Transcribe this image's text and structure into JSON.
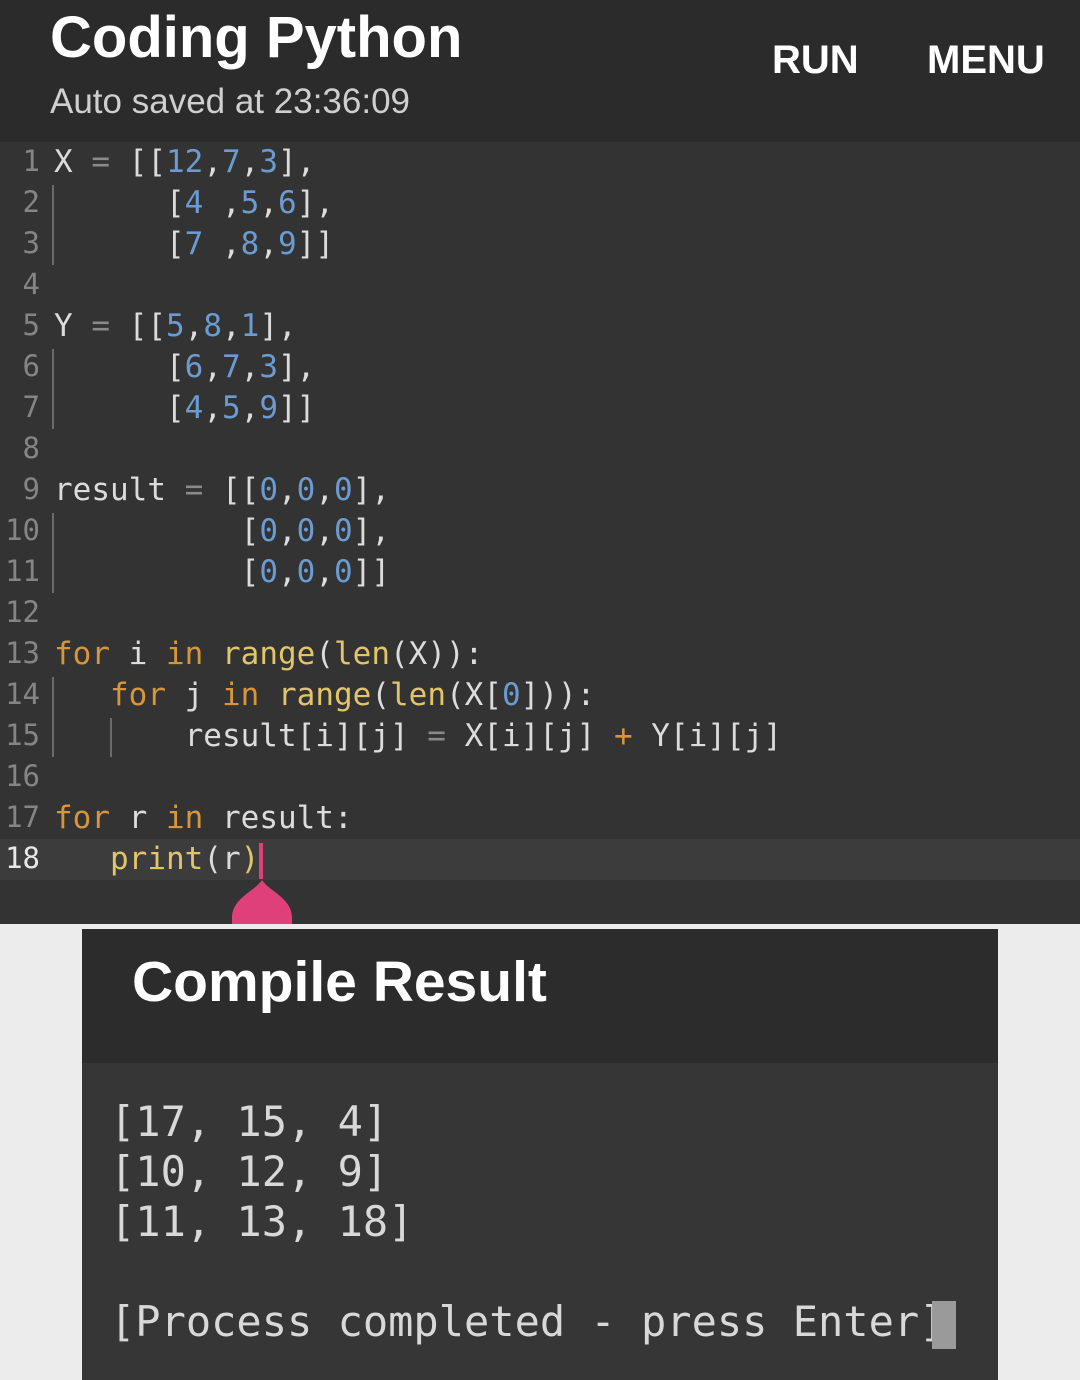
{
  "header": {
    "title": "Coding Python",
    "autosave": "Auto saved at 23:36:09",
    "run_label": "RUN",
    "menu_label": "MENU"
  },
  "editor": {
    "active_line": 18,
    "lines": [
      {
        "n": "1",
        "segments": [
          [
            "id",
            "X "
          ],
          [
            "op",
            "= "
          ],
          [
            "id",
            "[["
          ],
          [
            "num",
            "12"
          ],
          [
            "id",
            ","
          ],
          [
            "num",
            "7"
          ],
          [
            "id",
            ","
          ],
          [
            "num",
            "3"
          ],
          [
            "id",
            "],"
          ]
        ]
      },
      {
        "n": "2",
        "segments": [
          [
            "id",
            "      ["
          ],
          [
            "num",
            "4"
          ],
          [
            "id",
            " ,"
          ],
          [
            "num",
            "5"
          ],
          [
            "id",
            ","
          ],
          [
            "num",
            "6"
          ],
          [
            "id",
            "],"
          ]
        ]
      },
      {
        "n": "3",
        "segments": [
          [
            "id",
            "      ["
          ],
          [
            "num",
            "7"
          ],
          [
            "id",
            " ,"
          ],
          [
            "num",
            "8"
          ],
          [
            "id",
            ","
          ],
          [
            "num",
            "9"
          ],
          [
            "id",
            "]]"
          ]
        ]
      },
      {
        "n": "4",
        "segments": []
      },
      {
        "n": "5",
        "segments": [
          [
            "id",
            "Y "
          ],
          [
            "op",
            "= "
          ],
          [
            "id",
            "[["
          ],
          [
            "num",
            "5"
          ],
          [
            "id",
            ","
          ],
          [
            "num",
            "8"
          ],
          [
            "id",
            ","
          ],
          [
            "num",
            "1"
          ],
          [
            "id",
            "],"
          ]
        ]
      },
      {
        "n": "6",
        "segments": [
          [
            "id",
            "      ["
          ],
          [
            "num",
            "6"
          ],
          [
            "id",
            ","
          ],
          [
            "num",
            "7"
          ],
          [
            "id",
            ","
          ],
          [
            "num",
            "3"
          ],
          [
            "id",
            "],"
          ]
        ]
      },
      {
        "n": "7",
        "segments": [
          [
            "id",
            "      ["
          ],
          [
            "num",
            "4"
          ],
          [
            "id",
            ","
          ],
          [
            "num",
            "5"
          ],
          [
            "id",
            ","
          ],
          [
            "num",
            "9"
          ],
          [
            "id",
            "]]"
          ]
        ]
      },
      {
        "n": "8",
        "segments": []
      },
      {
        "n": "9",
        "segments": [
          [
            "id",
            "result "
          ],
          [
            "op",
            "= "
          ],
          [
            "id",
            "[["
          ],
          [
            "num",
            "0"
          ],
          [
            "id",
            ","
          ],
          [
            "num",
            "0"
          ],
          [
            "id",
            ","
          ],
          [
            "num",
            "0"
          ],
          [
            "id",
            "],"
          ]
        ]
      },
      {
        "n": "10",
        "segments": [
          [
            "id",
            "          ["
          ],
          [
            "num",
            "0"
          ],
          [
            "id",
            ","
          ],
          [
            "num",
            "0"
          ],
          [
            "id",
            ","
          ],
          [
            "num",
            "0"
          ],
          [
            "id",
            "],"
          ]
        ]
      },
      {
        "n": "11",
        "segments": [
          [
            "id",
            "          ["
          ],
          [
            "num",
            "0"
          ],
          [
            "id",
            ","
          ],
          [
            "num",
            "0"
          ],
          [
            "id",
            ","
          ],
          [
            "num",
            "0"
          ],
          [
            "id",
            "]]"
          ]
        ]
      },
      {
        "n": "12",
        "segments": []
      },
      {
        "n": "13",
        "segments": [
          [
            "kw",
            "for"
          ],
          [
            "id",
            " i "
          ],
          [
            "kw",
            "in"
          ],
          [
            "id",
            " "
          ],
          [
            "fn",
            "range"
          ],
          [
            "id",
            "("
          ],
          [
            "fn",
            "len"
          ],
          [
            "id",
            "(X)):"
          ]
        ]
      },
      {
        "n": "14",
        "segments": [
          [
            "id",
            "   "
          ],
          [
            "kw",
            "for"
          ],
          [
            "id",
            " j "
          ],
          [
            "kw",
            "in"
          ],
          [
            "id",
            " "
          ],
          [
            "fn",
            "range"
          ],
          [
            "id",
            "("
          ],
          [
            "fn",
            "len"
          ],
          [
            "id",
            "(X["
          ],
          [
            "num",
            "0"
          ],
          [
            "id",
            "])):"
          ]
        ]
      },
      {
        "n": "15",
        "segments": [
          [
            "id",
            "       result[i][j] "
          ],
          [
            "op",
            "="
          ],
          [
            "id",
            " X[i][j] "
          ],
          [
            "kw",
            "+"
          ],
          [
            "id",
            " Y[i][j]"
          ]
        ]
      },
      {
        "n": "16",
        "segments": []
      },
      {
        "n": "17",
        "segments": [
          [
            "kw",
            "for"
          ],
          [
            "id",
            " r "
          ],
          [
            "kw",
            "in"
          ],
          [
            "id",
            " result:"
          ]
        ]
      },
      {
        "n": "18",
        "segments": [
          [
            "id",
            "   "
          ],
          [
            "fn",
            "print"
          ],
          [
            "id",
            "(r"
          ],
          [
            "fn",
            ")"
          ]
        ]
      }
    ]
  },
  "compile_result": {
    "title": "Compile Result",
    "output": [
      "[17, 15, 4]",
      "[10, 12, 9]",
      "[11, 13, 18]"
    ],
    "status": "[Process completed - press Enter]"
  },
  "colors": {
    "keyword": "#d8963a",
    "function": "#e2c46a",
    "number": "#6b9bd1",
    "cursor": "#e0407a"
  }
}
